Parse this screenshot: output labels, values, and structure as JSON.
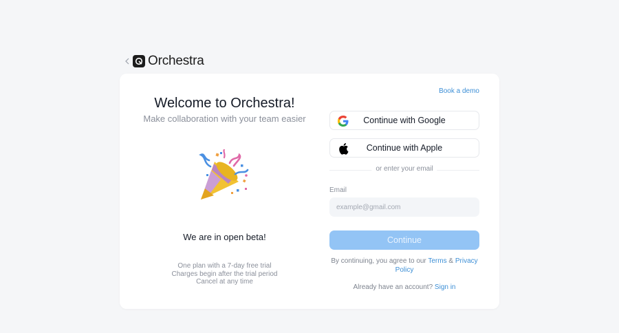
{
  "header": {
    "back_icon": "chevron-left-icon",
    "logo_icon": "orchestra-logo-icon",
    "brand": "Orchestra"
  },
  "left": {
    "title": "Welcome to Orchestra!",
    "subtitle": "Make collaboration with your team easier",
    "illustration": "party-popper-icon",
    "beta": "We are in open beta!",
    "plan_lines": [
      "One plan with a 7-day free trial",
      "Charges begin after the trial period",
      "Cancel at any time"
    ]
  },
  "right": {
    "book_demo": "Book a demo",
    "google": {
      "label": "Continue with Google",
      "icon": "google-icon"
    },
    "apple": {
      "label": "Continue with Apple",
      "icon": "apple-icon"
    },
    "divider": "or enter your email",
    "email": {
      "label": "Email",
      "placeholder": "example@gmail.com",
      "value": ""
    },
    "continue": "Continue",
    "terms": {
      "prefix": "By continuing, you agree to our ",
      "terms_link": "Terms",
      "and": " & ",
      "privacy_link": "Privacy Policy"
    },
    "signin": {
      "prefix": "Already have an account? ",
      "link": "Sign in"
    }
  },
  "colors": {
    "background": "#f5f6f8",
    "accent": "#3d8fd6",
    "continue_button": "#93c4f5"
  }
}
